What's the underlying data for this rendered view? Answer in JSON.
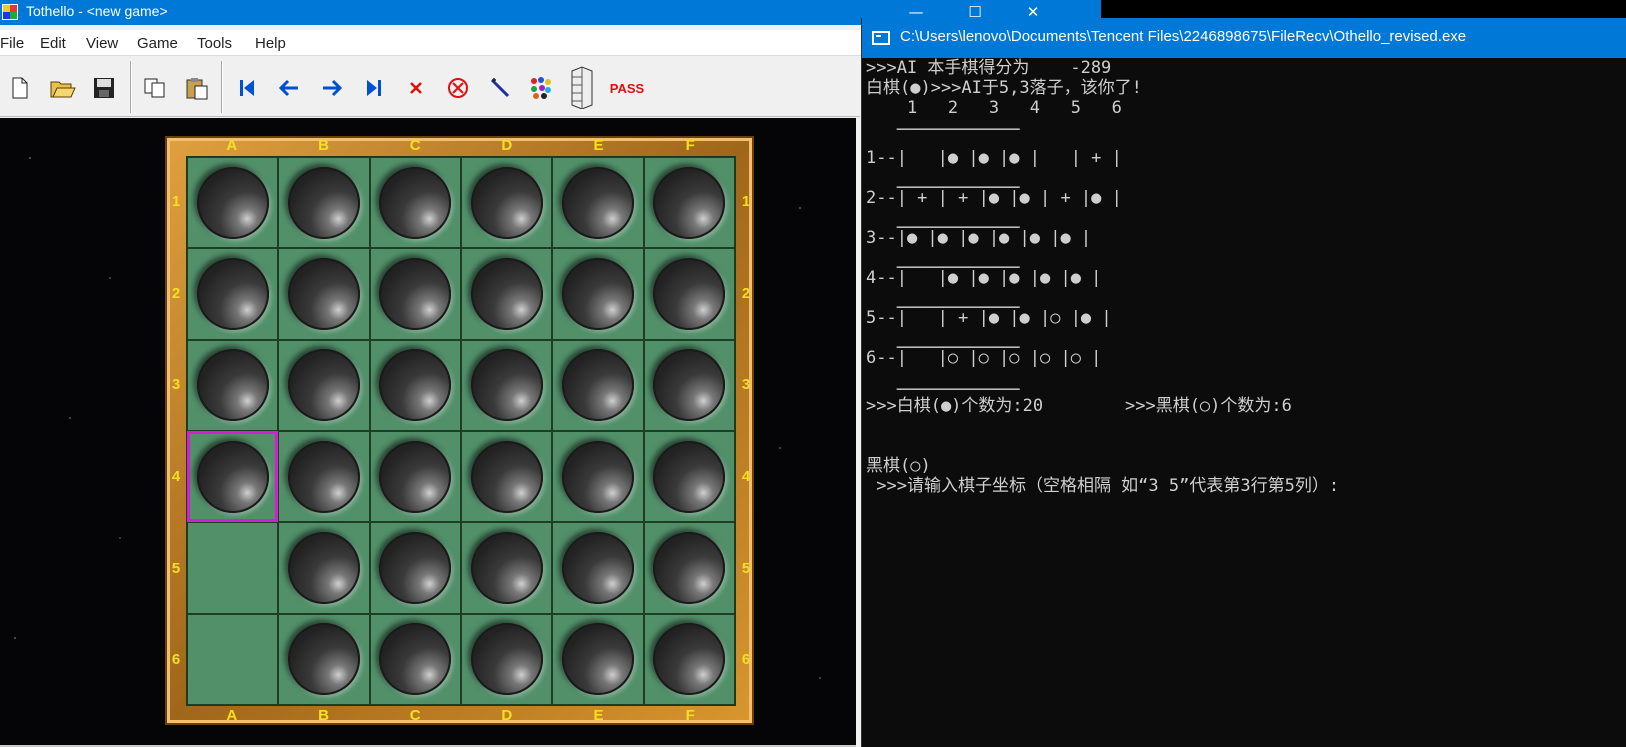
{
  "tothello": {
    "title": "Tothello - <new game>",
    "window_buttons": {
      "minimize": "—",
      "maximize": "☐",
      "close": "✕"
    },
    "menu": [
      "File",
      "Edit",
      "View",
      "Game",
      "Tools",
      "Help"
    ],
    "toolbar": {
      "pass_label": "PASS"
    },
    "board": {
      "columns": [
        "A",
        "B",
        "C",
        "D",
        "E",
        "F"
      ],
      "rows": [
        "1",
        "2",
        "3",
        "4",
        "5",
        "6"
      ],
      "cells": [
        [
          "black",
          "black",
          "black",
          "black",
          "black",
          "black"
        ],
        [
          "black",
          "black",
          "black",
          "black",
          "black",
          "black"
        ],
        [
          "black",
          "black",
          "black",
          "black",
          "black",
          "black"
        ],
        [
          "black",
          "black",
          "black",
          "black",
          "black",
          "black"
        ],
        [
          "empty",
          "black",
          "black",
          "black",
          "black",
          "black"
        ],
        [
          "empty",
          "black",
          "black",
          "black",
          "black",
          "black"
        ]
      ],
      "selected_cell": "A4"
    }
  },
  "console": {
    "title": "C:\\Users\\lenovo\\Documents\\Tencent Files\\2246898675\\FileRecv\\Othello_revised.exe",
    "lines": [
      ">>>AI 本手棋得分为    -289",
      "白棋(●)>>>AI于5,3落子，该你了!",
      "    1   2   3   4   5   6",
      "   ────────────",
      "1--|   |● |● |● |   | + |",
      "   ────────────",
      "2--| + | + |● |● | + |● |",
      "   ────────────",
      "3--|● |● |● |● |● |● |",
      "   ────────────",
      "4--|   |● |● |● |● |● |",
      "   ────────────",
      "5--|   | + |● |● |○ |● |",
      "   ────────────",
      "6--|   |○ |○ |○ |○ |○ |",
      "   ────────────",
      ">>>白棋(●)个数为:20        >>>黑棋(○)个数为:6",
      "",
      "",
      "黑棋(○)",
      " >>>请输入棋子坐标（空格相隔 如“3 5”代表第3行第5列）:"
    ]
  }
}
